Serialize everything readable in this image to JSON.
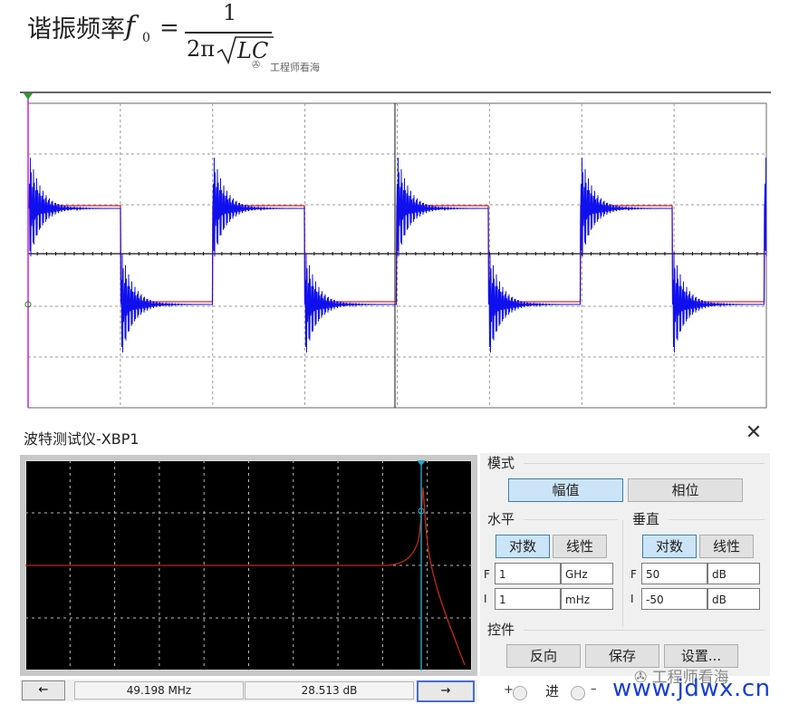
{
  "formula": {
    "label": "谐振频率",
    "lhs_symbol": "f",
    "lhs_sub": "0",
    "equals": "=",
    "numerator": "1",
    "denom_prefix": "2π",
    "denom_radicand": "LC",
    "watermark": "工程师看海"
  },
  "bode": {
    "title": "波特测试仪-XBP1",
    "close_label": "✕",
    "status": {
      "left_arrow": "←",
      "frequency": "49.198 MHz",
      "gain": "28.513 dB",
      "right_arrow": "→"
    }
  },
  "controls": {
    "mode_label": "模式",
    "magnitude_label": "幅值",
    "phase_label": "相位",
    "horizontal": {
      "label": "水平",
      "log_label": "对数",
      "linear_label": "线性",
      "f_label": "F",
      "f_value": "1",
      "f_unit": "GHz",
      "i_label": "I",
      "i_value": "1",
      "i_unit": "mHz"
    },
    "vertical": {
      "label": "垂直",
      "log_label": "对数",
      "linear_label": "线性",
      "f_label": "F",
      "f_value": "50",
      "f_unit": "dB",
      "i_label": "I",
      "i_value": "-50",
      "i_unit": "dB"
    },
    "controls_label": "控件",
    "reverse_label": "反向",
    "save_label": "保存",
    "settings_label": "设置...",
    "plus_label": "+",
    "in_label": "进",
    "minus_label": "–"
  },
  "watermarks": {
    "wechat": "工程师看海",
    "site": "www.jdwx.cn"
  },
  "colors": {
    "scope_red": "#e02020",
    "scope_blue": "#1010ee",
    "scope_cursor": "#d020d0",
    "bode_trace": "#c0281c",
    "bode_cursor": "#29a9c9",
    "site_watermark": "#1a3fd6"
  }
}
